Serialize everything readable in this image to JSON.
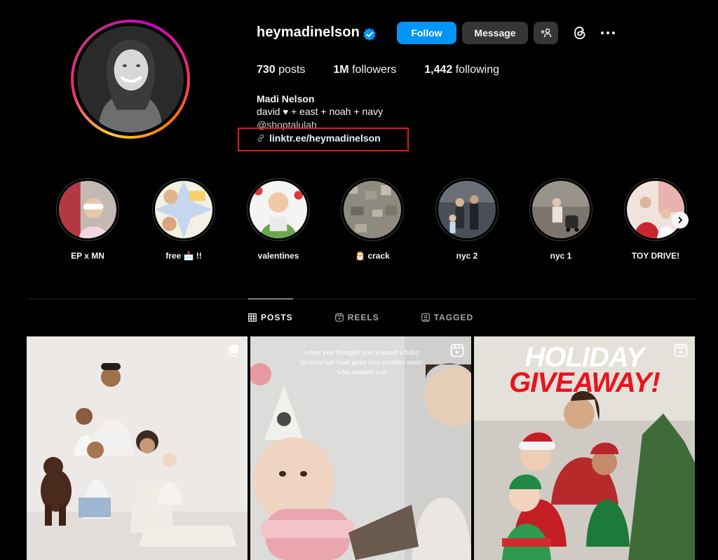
{
  "profile": {
    "username": "heymadinelson",
    "follow_label": "Follow",
    "message_label": "Message",
    "stats": {
      "posts_count": "730",
      "posts_label": "posts",
      "followers_count": "1M",
      "followers_label": "followers",
      "following_count": "1,442",
      "following_label": "following"
    },
    "bio": {
      "name": "Madi Nelson",
      "line1_pre": "david",
      "line1_post": "+ east + noah + navy",
      "mention": "@shoptalulah",
      "link": "linktr.ee/heymadinelson"
    }
  },
  "highlights": [
    {
      "label": "EP x MN"
    },
    {
      "label": "free 📩 !!"
    },
    {
      "label": "valentines"
    },
    {
      "label": "🎅 crack"
    },
    {
      "label": "nyc 2"
    },
    {
      "label": "nyc 1"
    },
    {
      "label": "TOY DRIVE!"
    }
  ],
  "tabs": [
    {
      "label": "POSTS",
      "icon": "grid-icon"
    },
    {
      "label": "REELS",
      "icon": "reels-icon"
    },
    {
      "label": "TAGGED",
      "icon": "tagged-icon"
    }
  ],
  "posts": [
    {
      "badge": "carousel-icon"
    },
    {
      "badge": "reels-icon",
      "caption": "when you thought you wanted a baby brother but God gave you another sister who needed you"
    },
    {
      "badge": "reels-icon",
      "title_line1": "HOLIDAY",
      "title_line2": "GIVEAWAY!"
    }
  ],
  "colors": {
    "follow_button": "#0095f6",
    "secondary_button": "#363636",
    "verified_badge": "#0095f6",
    "annotation_box": "#e0191e",
    "background": "#000000"
  }
}
